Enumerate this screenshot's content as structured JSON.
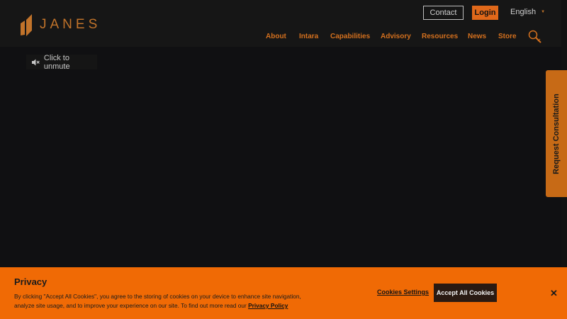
{
  "header": {
    "logo_text": "JANES",
    "contact_label": "Contact",
    "login_label": "Login",
    "language": "English",
    "nav": [
      "About",
      "Intara",
      "Capabilities",
      "Advisory",
      "Resources",
      "News",
      "Store"
    ]
  },
  "video": {
    "unmute_label": "Click to unmute"
  },
  "side_tab": {
    "label": "Request Consultation"
  },
  "cookie_banner": {
    "title": "Privacy",
    "body": "By clicking \"Accept All Cookies\", you agree to the storing of cookies on your device to enhance site navigation, analyze site usage, and to improve your experience on our site. To find out more read our",
    "link": "Privacy Policy",
    "settings_label": "Cookies Settings",
    "accept_label": "Accept All Cookies",
    "close_glyph": "✕"
  },
  "icons": {
    "logo": "janes-logo-mark",
    "search": "search-icon",
    "mute": "speaker-muted-icon",
    "language_caret": "caret-down-icon",
    "close": "close-icon"
  },
  "colors": {
    "accent": "#e0681a",
    "brand_text": "#c1732a",
    "banner": "#f06a05",
    "background": "#101012"
  }
}
